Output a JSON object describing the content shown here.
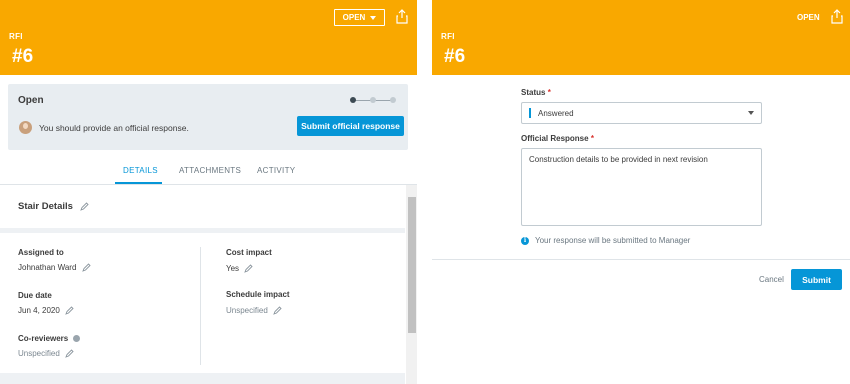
{
  "left": {
    "header": {
      "label": "RFI",
      "number": "#6",
      "open_button": "OPEN",
      "share_icon": "share-icon"
    },
    "status_card": {
      "title": "Open",
      "message": "You should provide an official response.",
      "submit_button": "Submit official response",
      "stepper_active_step": 1,
      "stepper_total_steps": 3
    },
    "tabs": [
      {
        "label": "DETAILS",
        "active": true
      },
      {
        "label": "ATTACHMENTS",
        "active": false
      },
      {
        "label": "ACTIVITY",
        "active": false
      }
    ],
    "details": {
      "section_title": "Stair Details",
      "assigned_to_label": "Assigned to",
      "assigned_to_value": "Johnathan Ward",
      "due_date_label": "Due date",
      "due_date_value": "Jun 4, 2020",
      "co_reviewers_label": "Co-reviewers",
      "co_reviewers_value": "Unspecified",
      "cost_impact_label": "Cost impact",
      "cost_impact_value": "Yes",
      "schedule_impact_label": "Schedule impact",
      "schedule_impact_value": "Unspecified"
    }
  },
  "right": {
    "header": {
      "label": "RFI",
      "number": "#6",
      "open_text": "OPEN",
      "share_icon": "share-icon"
    },
    "form": {
      "status_label": "Status",
      "status_value": "Answered",
      "response_label": "Official Response",
      "response_value": "Construction details to be provided in next revision",
      "note": "Your response will be submitted to Manager",
      "cancel": "Cancel",
      "submit": "Submit"
    }
  },
  "colors": {
    "header_bg": "#f9a800",
    "accent": "#0696d7",
    "required": "#d8322c"
  }
}
